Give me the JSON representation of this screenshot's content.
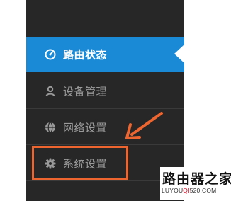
{
  "sidebar": {
    "items": [
      {
        "label": "路由状态",
        "icon": "gauge-icon",
        "active": true
      },
      {
        "label": "设备管理",
        "icon": "user-icon",
        "active": false
      },
      {
        "label": "网络设置",
        "icon": "globe-icon",
        "active": false
      },
      {
        "label": "系统设置",
        "icon": "gear-icon",
        "active": false
      }
    ]
  },
  "annotation": {
    "highlight_target": "系统设置",
    "color": "#ee6530"
  },
  "watermark": {
    "title": "路由器之家",
    "url_prefix": "LUYOU",
    "url_highlight": "QI",
    "url_suffix": "520.COM"
  },
  "colors": {
    "sidebar_bg": "#272727",
    "active_bg": "#1b8ad6",
    "inactive_text": "#9a9a9a",
    "active_text": "#ffffff"
  }
}
